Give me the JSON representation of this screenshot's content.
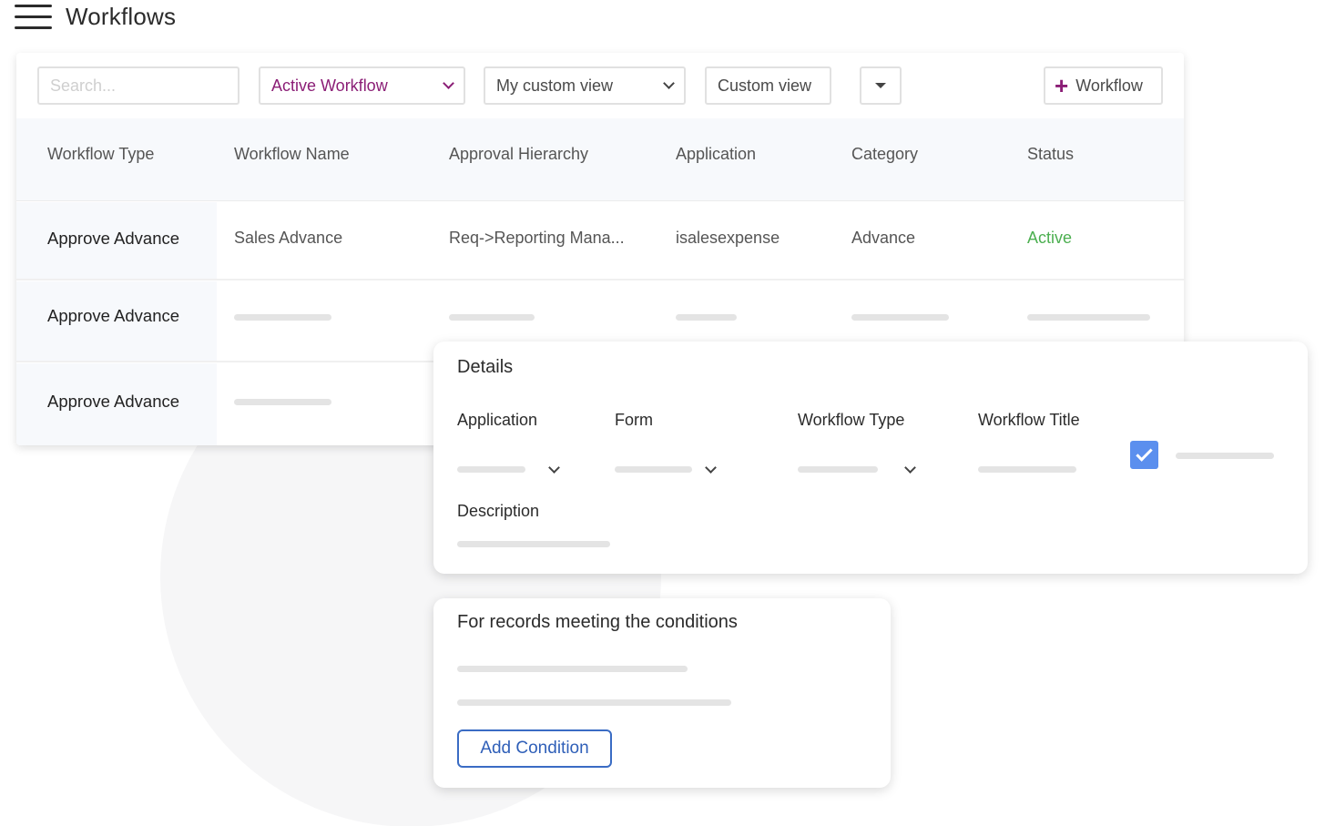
{
  "header": {
    "menu_icon": "hamburger-menu-icon",
    "title": "Workflows"
  },
  "toolbar": {
    "search_placeholder": "Search...",
    "workflow_filter": "Active Workflow",
    "view_select": "My custom view",
    "custom_view_label": "Custom view",
    "dropdown_icon": "triangle-down-icon",
    "add_workflow_label": "Workflow",
    "add_icon": "plus-icon",
    "accent_color": "#8b1e76"
  },
  "table": {
    "columns": [
      "Workflow Type",
      "Workflow Name",
      "Approval Hierarchy",
      "Application",
      "Category",
      "Status"
    ],
    "rows": [
      {
        "type": "Approve Advance",
        "name": "Sales Advance",
        "hierarchy": "Req->Reporting Mana...",
        "application": "isalesexpense",
        "category": "Advance",
        "status": "Active"
      },
      {
        "type": "Approve Advance"
      },
      {
        "type": "Approve Advance"
      }
    ],
    "status_active_color": "#4caf50"
  },
  "details": {
    "title": "Details",
    "fields": [
      "Application",
      "Form",
      "Workflow Type",
      "Workflow Title"
    ],
    "description_label": "Description",
    "checkbox_checked": true,
    "checkbox_color": "#5b8fee"
  },
  "conditions": {
    "title": "For records meeting the conditions",
    "add_button": "Add Condition",
    "button_color": "#3a6cc4"
  }
}
